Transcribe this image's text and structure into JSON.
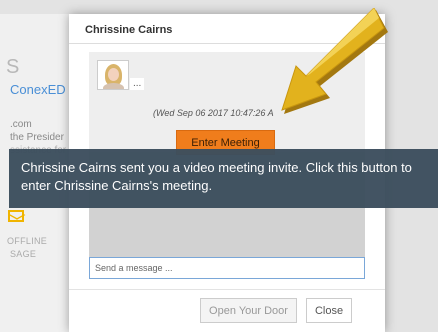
{
  "background_page": {
    "initial": "S",
    "company": "ConexED",
    "email_fragment": ".com",
    "role_fragment": "the Presider",
    "line_fragment": "ssistance for",
    "offline_label_top": "OFFLINE",
    "offline_label_bottom": "SAGE",
    "icon": "envelope-icon"
  },
  "dialog": {
    "title": "Chrissine Cairns",
    "message": {
      "avatar_icon": "user-avatar",
      "more_label": "...",
      "timestamp": "(Wed Sep 06 2017 10:47:26 A",
      "enter_button_label": "Enter Meeting"
    },
    "input_placeholder": "Send a message ...",
    "open_door_label": "Open Your Door",
    "close_label": "Close"
  },
  "tooltip": {
    "text": "Chrissine Cairns sent you a video meeting invite. Click this button to enter Chrissine Cairns's meeting."
  },
  "colors": {
    "accent_orange": "#f07d1c",
    "tooltip_bg": "#3d4f5e",
    "arrow_gold": "#e2b21d",
    "link_blue": "#4a8fd6"
  }
}
